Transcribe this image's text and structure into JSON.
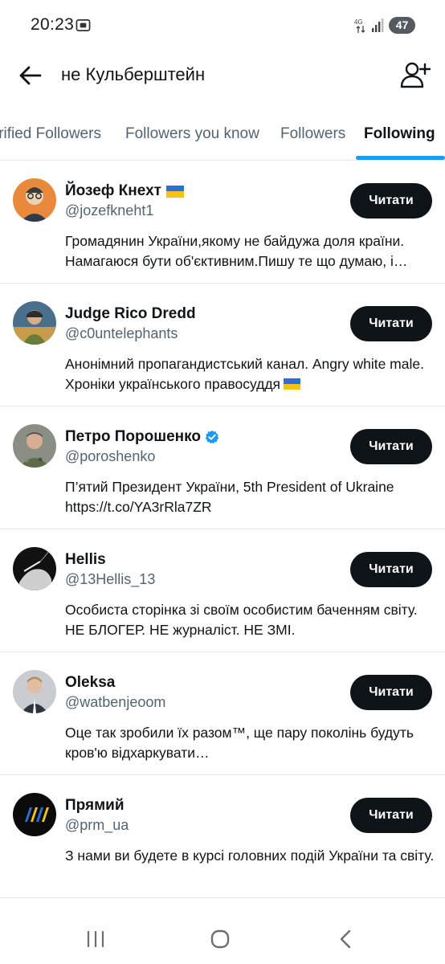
{
  "status_bar": {
    "time": "20:23",
    "network": "4G",
    "battery": "47"
  },
  "header": {
    "title": "не Кульберштейн",
    "back_icon": "arrow-left-icon",
    "add_user_icon": "add-user-icon"
  },
  "tabs": [
    {
      "label": "Verified Followers",
      "active": false
    },
    {
      "label": "Followers you know",
      "active": false
    },
    {
      "label": "Followers",
      "active": false
    },
    {
      "label": "Following",
      "active": true
    }
  ],
  "accent_color": "#1d9bf0",
  "follow_label": "Читати",
  "users": [
    {
      "name": "Йозеф Кнехт",
      "handle": "@jozefkneht1",
      "bio": "Громадянин України,якому не байдужа доля країни. Намагаюся бути об'єктивним.Пишу те що думаю, і…",
      "badge": "ukraine-flag"
    },
    {
      "name": "Judge Rico Dredd",
      "handle": "@c0untelephants",
      "bio": "Анонімний пропагандистський канал. Angry white male. Хроніки українського правосуддя",
      "badge": ""
    },
    {
      "name": "Петро Порошенко",
      "handle": "@poroshenko",
      "bio": "П’ятий Президент України, 5th President of Ukraine https://t.co/YA3rRla7ZR",
      "badge": "verified"
    },
    {
      "name": "Hellis",
      "handle": "@13Hellis_13",
      "bio": "Особиста сторінка зі своїм особистим баченням світу. НЕ БЛОГЕР. НЕ журналіст. НЕ ЗМІ.",
      "badge": ""
    },
    {
      "name": "Oleksa",
      "handle": "@watbenjeoom",
      "bio": "Оце так зробили їх разом™, ще пару поколінь будуть кров'ю відхаркувати…",
      "badge": ""
    },
    {
      "name": "Прямий",
      "handle": "@prm_ua",
      "bio": "З нами ви будете в курсі головних подій України та світу.",
      "badge": ""
    }
  ],
  "nav": {
    "recents_icon": "recents-icon",
    "home_icon": "home-icon",
    "back_icon": "back-chevron-icon"
  }
}
